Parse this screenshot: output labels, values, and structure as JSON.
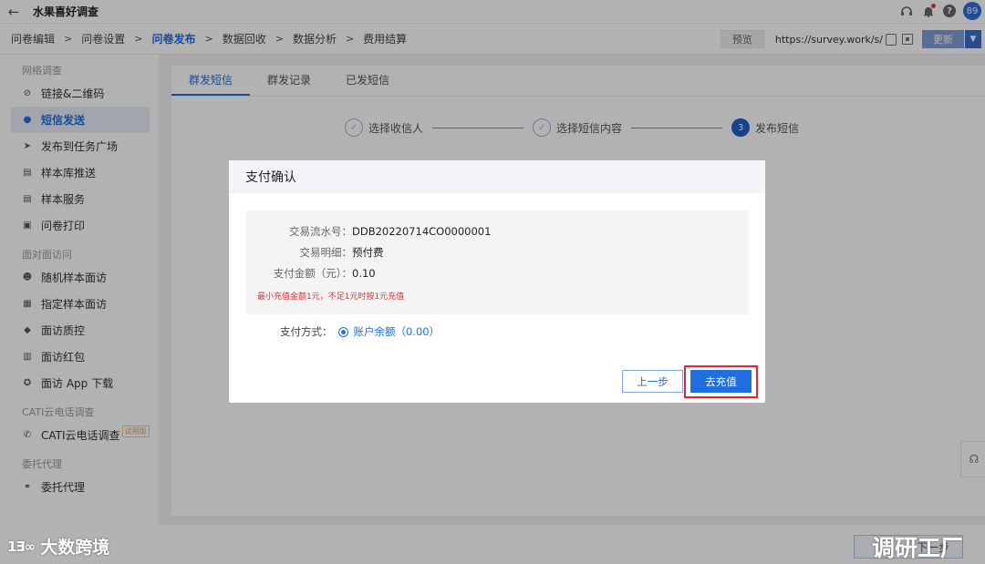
{
  "app": {
    "title": "水果喜好调查"
  },
  "header": {
    "avatar_text": "89"
  },
  "stepnav": {
    "items": [
      "问卷编辑",
      "问卷设置",
      "问卷发布",
      "数据回收",
      "数据分析",
      "费用结算"
    ],
    "active_index": 2,
    "preview_label": "预览",
    "url": "https://survey.work/s/",
    "update_label": "更新"
  },
  "sidebar": {
    "groups": [
      {
        "title": "网络调查",
        "items": [
          {
            "label": "链接&二维码",
            "icon": "link-icon"
          },
          {
            "label": "短信发送",
            "icon": "chat-icon",
            "active": true
          },
          {
            "label": "发布到任务广场",
            "icon": "send-icon"
          },
          {
            "label": "样本库推送",
            "icon": "doc-icon"
          },
          {
            "label": "样本服务",
            "icon": "doc-icon"
          },
          {
            "label": "问卷打印",
            "icon": "printer-icon"
          }
        ]
      },
      {
        "title": "面对面访问",
        "items": [
          {
            "label": "随机样本面访",
            "icon": "user-icon"
          },
          {
            "label": "指定样本面访",
            "icon": "list-icon"
          },
          {
            "label": "面访质控",
            "icon": "shield-icon"
          },
          {
            "label": "面访红包",
            "icon": "gift-icon"
          },
          {
            "label": "面访 App 下载",
            "icon": "android-icon"
          }
        ]
      },
      {
        "title": "CATI云电话调查",
        "items": [
          {
            "label": "CATI云电话调查",
            "icon": "phone-icon",
            "tag": "试用版"
          }
        ]
      },
      {
        "title": "委托代理",
        "items": [
          {
            "label": "委托代理",
            "icon": "handshake-icon"
          }
        ]
      }
    ]
  },
  "main": {
    "tabs": [
      "群发短信",
      "群发记录",
      "已发短信"
    ],
    "steps": [
      "选择收信人",
      "选择短信内容",
      "发布短信"
    ],
    "current_step_number": "3",
    "next_label": "下一步"
  },
  "modal": {
    "title": "支付确认",
    "rows": [
      {
        "label": "交易流水号：",
        "value": "DDB20220714CO0000001"
      },
      {
        "label": "交易明细：",
        "value": "预付费"
      },
      {
        "label": "支付金额（元）：",
        "value": "0.10"
      }
    ],
    "note": "最小充值金额1元，不足1元时按1元充值",
    "pay_method_label": "支付方式：",
    "pay_option": "账户余额（0.00）",
    "prev_label": "上一步",
    "recharge_label": "去充值"
  },
  "watermarks": {
    "left_logo": "1Ǝ∞",
    "left_text": "大数跨境",
    "right_text": "调研工厂"
  },
  "colors": {
    "accent": "#1f6fe0",
    "highlight": "#e0262e",
    "note": "#e0333a"
  }
}
